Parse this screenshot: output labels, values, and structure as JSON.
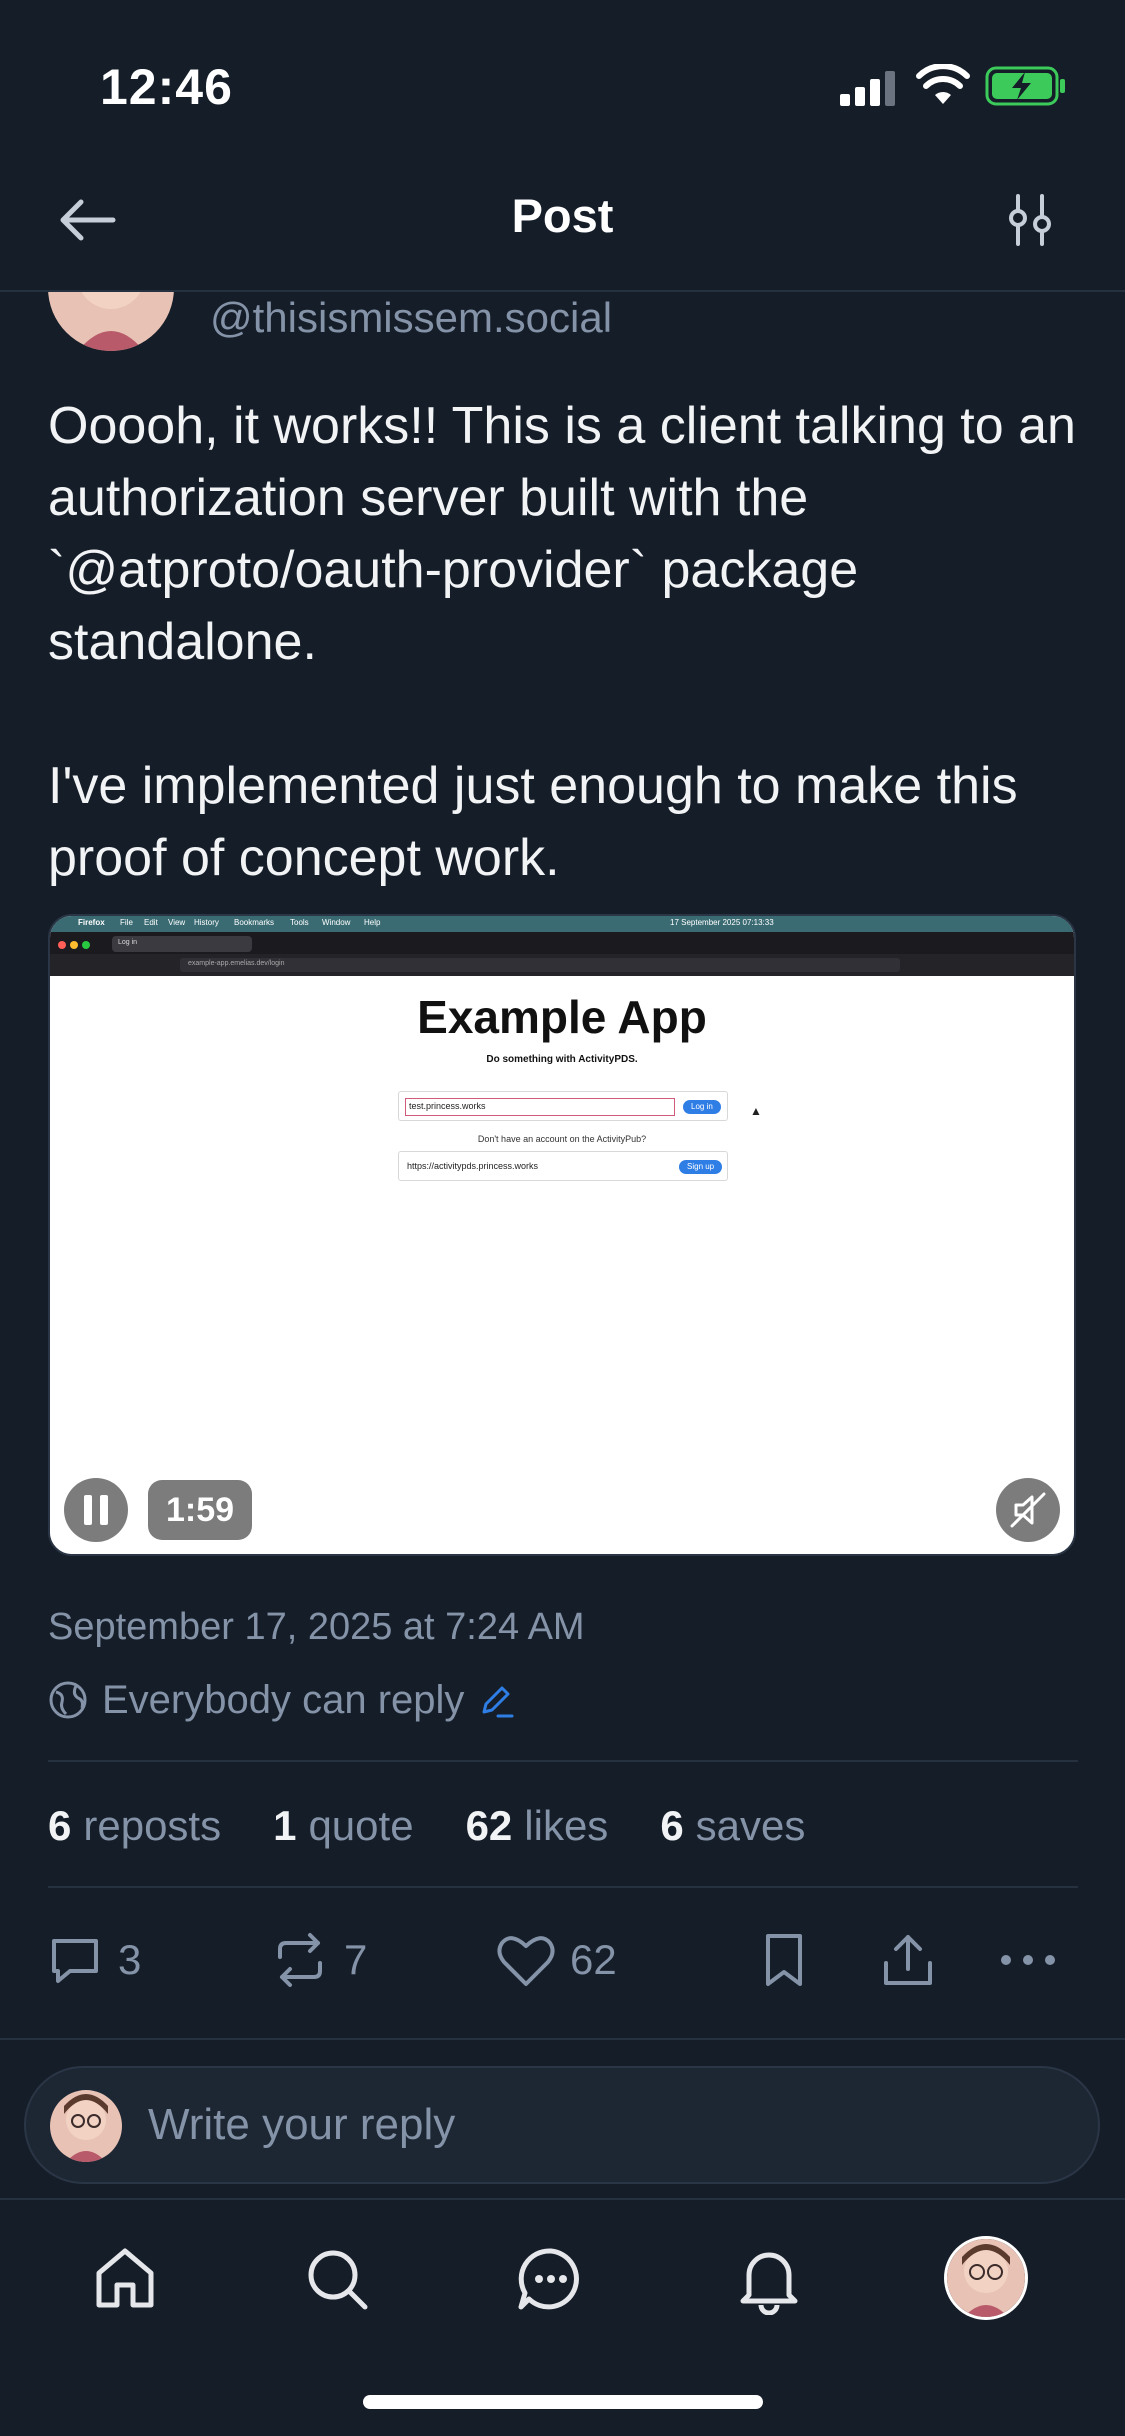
{
  "status_bar": {
    "time": "12:46",
    "icons": [
      "cellular-signal-icon",
      "wifi-icon",
      "battery-charging-icon"
    ],
    "battery_color": "#3ccb5a"
  },
  "header": {
    "title": "Post",
    "back_icon": "arrow-left-icon",
    "filter_icon": "sliders-icon"
  },
  "post": {
    "author_handle": "@thisismissem.social",
    "paragraphs": [
      "Ooooh, it works!! This is a client talking to an authorization server built with the `@atproto/oauth-provider` package standalone.",
      "I've implemented just enough to make this proof of concept work."
    ],
    "video": {
      "duration": "1:59",
      "screen": {
        "menubar_app": "Firefox",
        "menubar_items": [
          "File",
          "Edit",
          "View",
          "History",
          "Bookmarks",
          "Tools",
          "Window",
          "Help"
        ],
        "menubar_date": "17 September 2025 07:13:33",
        "tab_title": "Log in",
        "url": "example-app.emelias.dev/login",
        "app_title": "Example App",
        "app_subtitle": "Do something with ActivityPDS.",
        "login_value": "test.princess.works",
        "login_button": "Log in",
        "no_account_text": "Don't have an account on the ActivityPub?",
        "signup_value": "https://activitypds.princess.works",
        "signup_button": "Sign up"
      }
    },
    "date": "September 17, 2025 at 7:24 AM",
    "reply_setting": "Everybody can reply",
    "stats": [
      {
        "count": "6",
        "label": "reposts"
      },
      {
        "count": "1",
        "label": "quote"
      },
      {
        "count": "62",
        "label": "likes"
      },
      {
        "count": "6",
        "label": "saves"
      }
    ],
    "actions": {
      "replies": "3",
      "reposts": "7",
      "likes": "62"
    }
  },
  "reply_composer": {
    "placeholder": "Write your reply"
  },
  "tab_bar": {
    "tabs": [
      "home-icon",
      "search-icon",
      "chat-icon",
      "notifications-bell-icon",
      "profile-avatar"
    ]
  },
  "colors": {
    "background": "#151d28",
    "muted_text": "#8593a8",
    "accent": "#2f7ee6"
  }
}
